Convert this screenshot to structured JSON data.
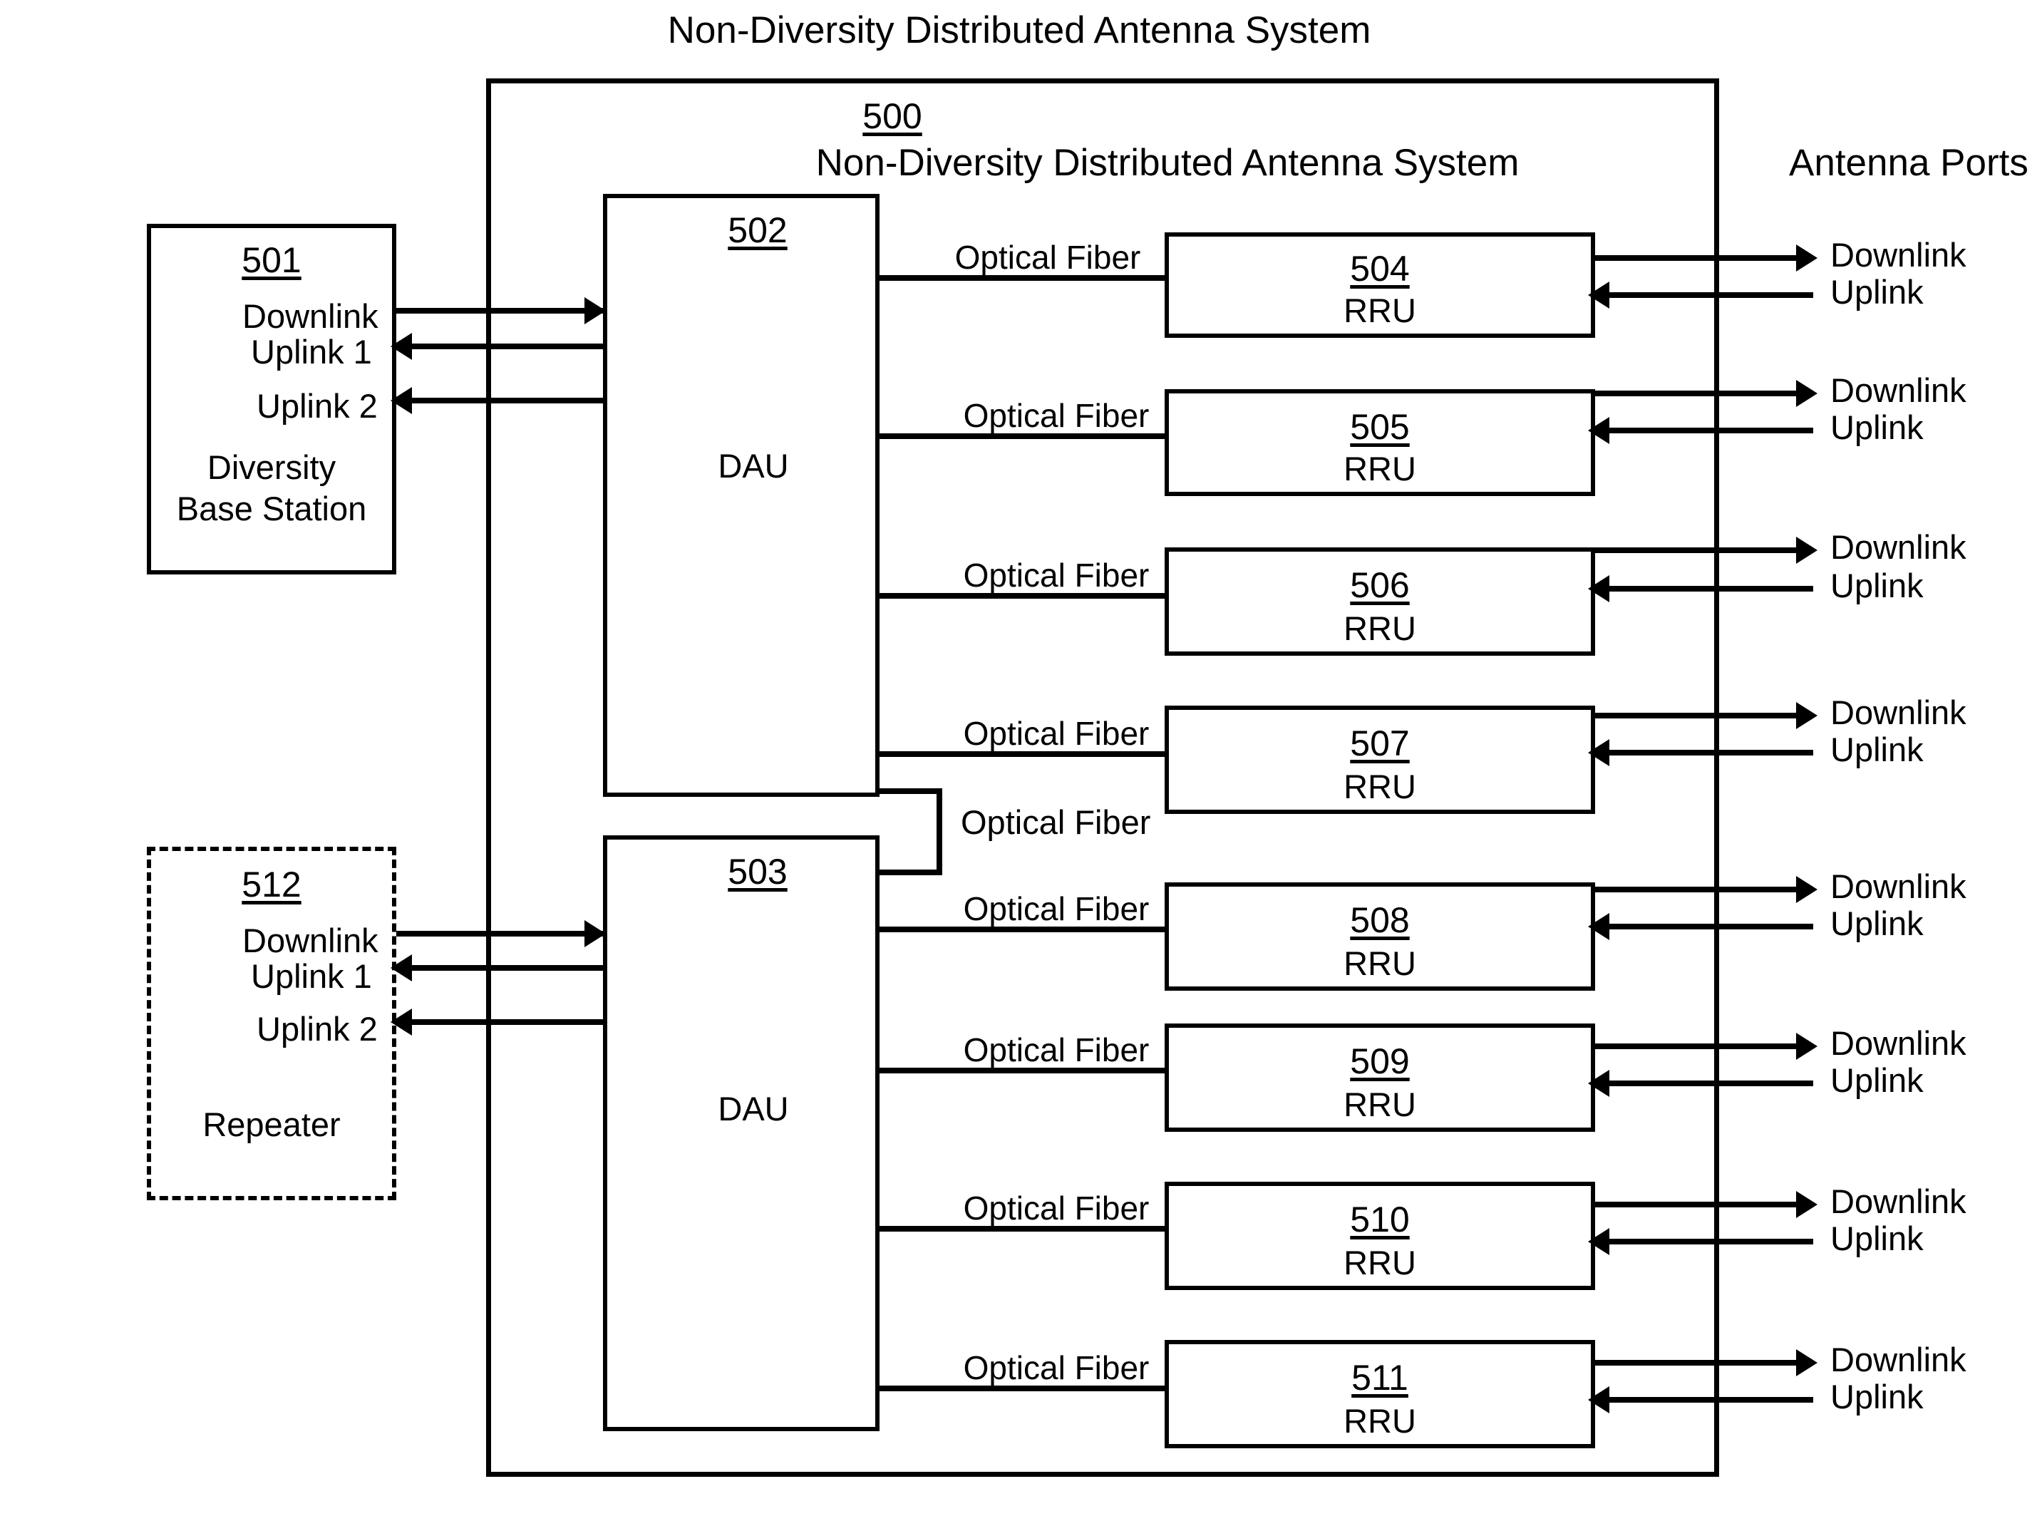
{
  "figure": {
    "title": "Non-Diversity Distributed Antenna System",
    "system_ref": "500",
    "system_label": "Non-Diversity Distributed Antenna System",
    "antenna_ports_label": "Antenna Ports",
    "fiber_label": "Optical Fiber",
    "downlink_label": "Downlink",
    "uplink_label": "Uplink",
    "uplink1_label": "Uplink 1",
    "uplink2_label": "Uplink 2"
  },
  "sources": [
    {
      "ref": "501",
      "name": "Diversity Base Station",
      "name_line1": "Diversity",
      "name_line2": "Base Station",
      "style": "solid",
      "ports": [
        "Downlink",
        "Uplink 1",
        "Uplink 2"
      ]
    },
    {
      "ref": "512",
      "name": "Repeater",
      "name_line1": "Repeater",
      "name_line2": "",
      "style": "dashed",
      "ports": [
        "Downlink",
        "Uplink 1",
        "Uplink 2"
      ]
    }
  ],
  "daus": [
    {
      "ref": "502",
      "label": "DAU"
    },
    {
      "ref": "503",
      "label": "DAU"
    }
  ],
  "rrus": [
    {
      "ref": "504",
      "label": "RRU",
      "fiber": "Optical Fiber",
      "ports": [
        "Downlink",
        "Uplink"
      ]
    },
    {
      "ref": "505",
      "label": "RRU",
      "fiber": "Optical Fiber",
      "ports": [
        "Downlink",
        "Uplink"
      ]
    },
    {
      "ref": "506",
      "label": "RRU",
      "fiber": "Optical Fiber",
      "ports": [
        "Downlink",
        "Uplink"
      ]
    },
    {
      "ref": "507",
      "label": "RRU",
      "fiber": "Optical Fiber",
      "ports": [
        "Downlink",
        "Uplink"
      ]
    },
    {
      "ref": "508",
      "label": "RRU",
      "fiber": "Optical Fiber",
      "ports": [
        "Downlink",
        "Uplink"
      ]
    },
    {
      "ref": "509",
      "label": "RRU",
      "fiber": "Optical Fiber",
      "ports": [
        "Downlink",
        "Uplink"
      ]
    },
    {
      "ref": "510",
      "label": "RRU",
      "fiber": "Optical Fiber",
      "ports": [
        "Downlink",
        "Uplink"
      ]
    },
    {
      "ref": "511",
      "label": "RRU",
      "fiber": "Optical Fiber",
      "ports": [
        "Downlink",
        "Uplink"
      ]
    }
  ],
  "interconnect": {
    "fiber": "Optical Fiber"
  },
  "colors": {
    "line": "#000000",
    "background": "#ffffff",
    "text": "#000000"
  }
}
